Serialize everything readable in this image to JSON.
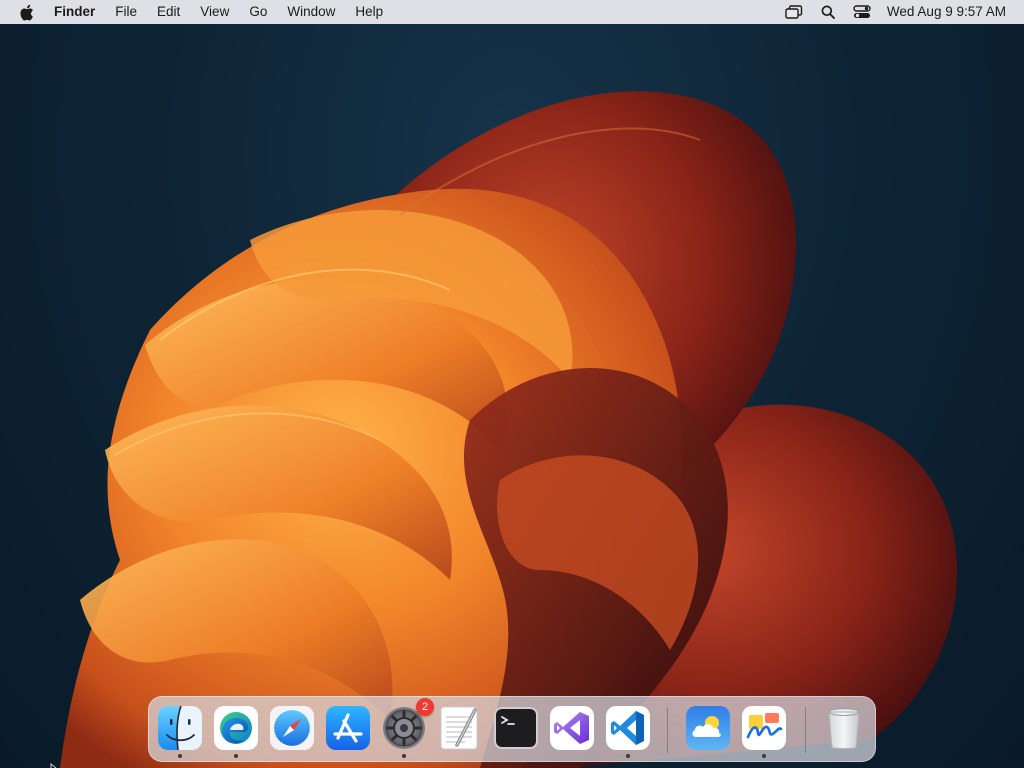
{
  "menubar": {
    "apple_icon": "apple-logo-icon",
    "app_name": "Finder",
    "items": [
      {
        "label": "File"
      },
      {
        "label": "Edit"
      },
      {
        "label": "View"
      },
      {
        "label": "Go"
      },
      {
        "label": "Window"
      },
      {
        "label": "Help"
      }
    ],
    "status_icons": [
      "screen-mirroring-icon",
      "spotlight-search-icon",
      "control-center-icon"
    ],
    "clock": "Wed Aug 9  9:57 AM"
  },
  "dock": {
    "apps": [
      {
        "name": "Finder",
        "icon": "finder-icon",
        "running": true
      },
      {
        "name": "Microsoft Edge",
        "icon": "edge-icon",
        "running": true
      },
      {
        "name": "Safari",
        "icon": "safari-icon",
        "running": false
      },
      {
        "name": "App Store",
        "icon": "app-store-icon",
        "running": false
      },
      {
        "name": "System Settings",
        "icon": "system-settings-icon",
        "running": true,
        "badge": "2"
      },
      {
        "name": "TextEdit",
        "icon": "textedit-icon",
        "running": false
      },
      {
        "name": "Terminal",
        "icon": "terminal-icon",
        "running": false
      },
      {
        "name": "Visual Studio",
        "icon": "visual-studio-icon",
        "running": false
      },
      {
        "name": "Visual Studio Code",
        "icon": "vscode-icon",
        "running": true
      },
      {
        "name": "Weather",
        "icon": "weather-icon",
        "running": false
      },
      {
        "name": "Freeform",
        "icon": "freeform-icon",
        "running": true
      },
      {
        "name": "Trash",
        "icon": "trash-icon",
        "running": false
      }
    ]
  },
  "colors": {
    "menubar_bg": "#e8e8ec",
    "desktop_bg": "#0d2233",
    "wallpaper_orange": "#f28a2a",
    "wallpaper_deep_red": "#7a1f1a",
    "badge_red": "#ee3a30"
  }
}
